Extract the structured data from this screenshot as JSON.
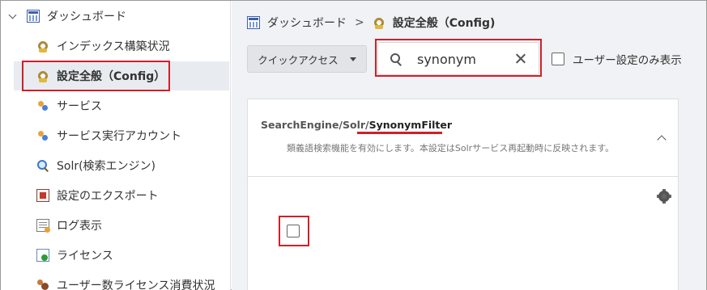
{
  "sidebar": {
    "root_label": "ダッシュボード",
    "items": [
      {
        "label": "インデックス構築状況",
        "icon": "gear-icon"
      },
      {
        "label": "設定全般（Config）",
        "icon": "gear-icon",
        "active": true
      },
      {
        "label": "サービス",
        "icon": "dots-icon"
      },
      {
        "label": "サービス実行アカウント",
        "icon": "dots-icon"
      },
      {
        "label": "Solr(検索エンジン)",
        "icon": "search-icon"
      },
      {
        "label": "設定のエクスポート",
        "icon": "export-icon"
      },
      {
        "label": "ログ表示",
        "icon": "log-icon"
      },
      {
        "label": "ライセンス",
        "icon": "license-icon"
      },
      {
        "label": "ユーザー数ライセンス消費状況",
        "icon": "users-icon"
      }
    ]
  },
  "breadcrumb": {
    "home": "ダッシュボード",
    "separator": ">",
    "current": "設定全般（Config)"
  },
  "toolbar": {
    "quick_access_label": "クイックアクセス",
    "search_value": "synonym",
    "user_settings_only_label": "ユーザー設定のみ表示"
  },
  "card": {
    "path_prefix": "SearchEngine/Solr/",
    "path_name": "SynonymFilter",
    "description": "類義語検索機能を有効にします。本設定はSolrサービス再起動時に反映されます。",
    "checked": false
  },
  "colors": {
    "highlight": "#d0202a",
    "active_bg": "#e8ebf0",
    "main_bg": "#f0f2f5"
  }
}
